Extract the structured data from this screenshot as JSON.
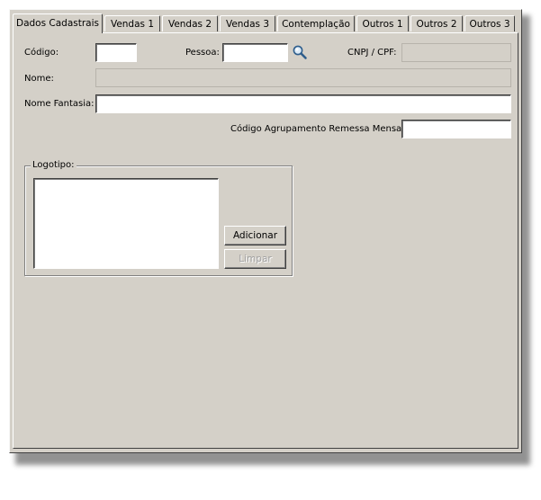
{
  "tabs": [
    {
      "label": "Dados Cadastrais",
      "active": true
    },
    {
      "label": "Vendas 1",
      "active": false
    },
    {
      "label": "Vendas 2",
      "active": false
    },
    {
      "label": "Vendas 3",
      "active": false
    },
    {
      "label": "Contemplação",
      "active": false
    },
    {
      "label": "Outros 1",
      "active": false
    },
    {
      "label": "Outros 2",
      "active": false
    },
    {
      "label": "Outros 3",
      "active": false
    }
  ],
  "form": {
    "codigo": {
      "label": "Código:",
      "value": ""
    },
    "pessoa": {
      "label": "Pessoa:",
      "value": "",
      "search_icon": "magnifier-icon"
    },
    "cnpj_cpf": {
      "label": "CNPJ / CPF:",
      "value": ""
    },
    "nome": {
      "label": "Nome:",
      "value": ""
    },
    "nome_fantasia": {
      "label": "Nome Fantasia:",
      "value": ""
    },
    "codigo_agrupamento": {
      "label": "Código Agrupamento Remessa Mensal:",
      "value": ""
    }
  },
  "logotipo": {
    "legend": "Logotipo:",
    "add_button": "Adicionar",
    "clear_button": "Limpar"
  }
}
